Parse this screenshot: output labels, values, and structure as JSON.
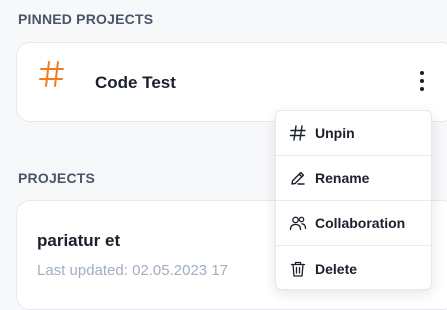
{
  "sections": {
    "pinned_label": "PINNED PROJECTS",
    "projects_label": "PROJECTS"
  },
  "pinned_project": {
    "title": "Code Test",
    "icon": "hash-icon",
    "accent_color": "#f07c1e"
  },
  "project": {
    "title": "pariatur et",
    "last_updated": "Last updated: 02.05.2023 17"
  },
  "context_menu": {
    "items": [
      {
        "label": "Unpin",
        "icon": "hash-icon"
      },
      {
        "label": "Rename",
        "icon": "edit-icon"
      },
      {
        "label": "Collaboration",
        "icon": "users-icon"
      },
      {
        "label": "Delete",
        "icon": "trash-icon"
      }
    ]
  }
}
